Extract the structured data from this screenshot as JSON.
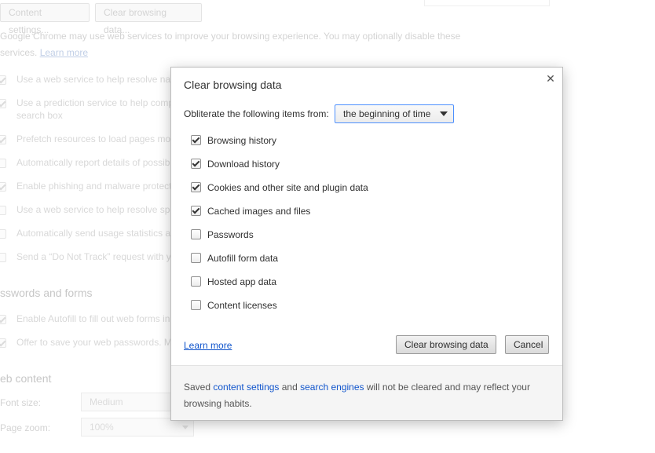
{
  "background": {
    "top_buttons": [
      "Content settings...",
      "Clear browsing data..."
    ],
    "privacy_note_line1": "Google Chrome may use web services to improve your browsing experience. You may optionally disable these",
    "privacy_note_line2_prefix": "services.",
    "privacy_learn_more": "Learn more",
    "privacy_items": [
      {
        "label": "Use a web service to help resolve nav",
        "checked": true
      },
      {
        "label": "Use a prediction service to help comp",
        "checked": true
      },
      {
        "label": "search box",
        "checked": null
      },
      {
        "label": "Prefetch resources to load pages mo",
        "checked": true
      },
      {
        "label": "Automatically report details of possib",
        "checked": false
      },
      {
        "label": "Enable phishing and malware protect",
        "checked": true
      },
      {
        "label": "Use a web service to help resolve spe",
        "checked": false
      },
      {
        "label": "Automatically send usage statistics a",
        "checked": false
      },
      {
        "label": "Send a “Do Not Track” request with y",
        "checked": false
      }
    ],
    "passwords_section": "sswords and forms",
    "passwords_items": [
      {
        "label": "Enable Autofill to fill out web forms in",
        "checked": true
      },
      {
        "label": "Offer to save your web passwords. M",
        "checked": true
      }
    ],
    "web_content_section": "eb content",
    "font_size_label": "Font size:",
    "font_size_value": "Medium",
    "page_zoom_label": "Page zoom:",
    "page_zoom_value": "100%"
  },
  "dialog": {
    "title": "Clear browsing data",
    "close_glyph": "✕",
    "obliterate_label": "Obliterate the following items from:",
    "time_range": "the beginning of time",
    "items": [
      {
        "label": "Browsing history",
        "checked": true
      },
      {
        "label": "Download history",
        "checked": true
      },
      {
        "label": "Cookies and other site and plugin data",
        "checked": true
      },
      {
        "label": "Cached images and files",
        "checked": true
      },
      {
        "label": "Passwords",
        "checked": false
      },
      {
        "label": "Autofill form data",
        "checked": false
      },
      {
        "label": "Hosted app data",
        "checked": false
      },
      {
        "label": "Content licenses",
        "checked": false
      }
    ],
    "learn_more": "Learn more",
    "clear_button": "Clear browsing data",
    "cancel_button": "Cancel",
    "footer": {
      "text1": "Saved ",
      "link1": "content settings",
      "text2": " and ",
      "link2": "search engines",
      "text3": " will not be cleared and may reflect your",
      "text4": "browsing habits."
    }
  }
}
